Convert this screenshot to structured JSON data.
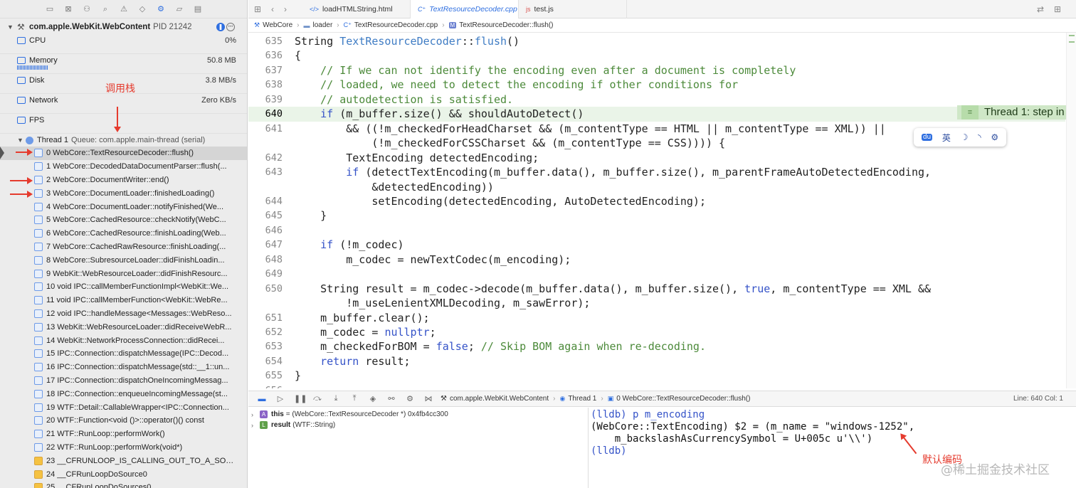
{
  "navigator": {
    "process": {
      "name": "com.apple.WebKit.WebContent",
      "pid": "PID 21242"
    },
    "gauges": [
      {
        "label": "CPU",
        "value": "0%"
      },
      {
        "label": "Memory",
        "value": "50.8 MB"
      },
      {
        "label": "Disk",
        "value": "3.8 MB/s"
      },
      {
        "label": "Network",
        "value": "Zero KB/s"
      },
      {
        "label": "FPS",
        "value": ""
      }
    ],
    "annotation": "调用栈",
    "thread": {
      "name": "Thread 1",
      "queue": "Queue: com.apple.main-thread (serial)"
    },
    "frames": [
      "0 WebCore::TextResourceDecoder::flush()",
      "1 WebCore::DecodedDataDocumentParser::flush(...",
      "2 WebCore::DocumentWriter::end()",
      "3 WebCore::DocumentLoader::finishedLoading()",
      "4 WebCore::DocumentLoader::notifyFinished(We...",
      "5 WebCore::CachedResource::checkNotify(WebC...",
      "6 WebCore::CachedResource::finishLoading(Web...",
      "7 WebCore::CachedRawResource::finishLoading(...",
      "8 WebCore::SubresourceLoader::didFinishLoadin...",
      "9 WebKit::WebResourceLoader::didFinishResourc...",
      "10 void IPC::callMemberFunctionImpl<WebKit::We...",
      "11 void IPC::callMemberFunction<WebKit::WebRe...",
      "12 void IPC::handleMessage<Messages::WebReso...",
      "13 WebKit::WebResourceLoader::didReceiveWebR...",
      "14 WebKit::NetworkProcessConnection::didRecei...",
      "15 IPC::Connection::dispatchMessage(IPC::Decod...",
      "16 IPC::Connection::dispatchMessage(std::__1::un...",
      "17 IPC::Connection::dispatchOneIncomingMessag...",
      "18 IPC::Connection::enqueueIncomingMessage(st...",
      "19 WTF::Detail::CallableWrapper<IPC::Connection...",
      "20 WTF::Function<void ()>::operator()() const",
      "21 WTF::RunLoop::performWork()",
      "22 WTF::RunLoop::performWork(void*)",
      "23 __CFRUNLOOP_IS_CALLING_OUT_TO_A_SOU...",
      "24 __CFRunLoopDoSource0",
      "25 __CFRunLoopDoSources0"
    ]
  },
  "tabs": [
    {
      "icon": "</>",
      "label": "loadHTMLString.html"
    },
    {
      "icon": "C⁺",
      "label": "TextResourceDecoder.cpp"
    },
    {
      "icon": "js",
      "label": "test.js"
    }
  ],
  "jumpbar": {
    "items": [
      "WebCore",
      "loader",
      "TextResourceDecoder.cpp",
      "TextResourceDecoder::flush()"
    ]
  },
  "editor": {
    "current_line": "640",
    "step_badge": "Thread 1: step in",
    "lines": [
      {
        "num": "635",
        "html": "String <span class=\"fn\">TextResourceDecoder</span>::<span class=\"fn\">flush</span>()"
      },
      {
        "num": "636",
        "html": "{"
      },
      {
        "num": "637",
        "html": "    <span class=\"cm\">// If we can not identify the encoding even after a document is completely</span>"
      },
      {
        "num": "638",
        "html": "    <span class=\"cm\">// loaded, we need to detect the encoding if other conditions for</span>"
      },
      {
        "num": "639",
        "html": "    <span class=\"cm\">// autodetection is satisfied.</span>"
      },
      {
        "num": "640",
        "html": "    <span class=\"kw\">if</span> (m_buffer.size() && shouldAutoDetect()"
      },
      {
        "num": "641",
        "html": "        && ((!m_checkedForHeadCharset && (m_contentType == HTML || m_contentType == XML)) ||"
      },
      {
        "num": "",
        "html": "            (!m_checkedForCSSCharset && (m_contentType == CSS)))) {"
      },
      {
        "num": "642",
        "html": "        TextEncoding detectedEncoding;"
      },
      {
        "num": "643",
        "html": "        <span class=\"kw\">if</span> (detectTextEncoding(m_buffer.data(), m_buffer.size(), m_parentFrameAutoDetectedEncoding,"
      },
      {
        "num": "",
        "html": "            &detectedEncoding))"
      },
      {
        "num": "644",
        "html": "            setEncoding(detectedEncoding, AutoDetectedEncoding);"
      },
      {
        "num": "645",
        "html": "    }"
      },
      {
        "num": "646",
        "html": ""
      },
      {
        "num": "647",
        "html": "    <span class=\"kw\">if</span> (!m_codec)"
      },
      {
        "num": "648",
        "html": "        m_codec = newTextCodec(m_encoding);"
      },
      {
        "num": "649",
        "html": ""
      },
      {
        "num": "650",
        "html": "    String result = m_codec->decode(m_buffer.data(), m_buffer.size(), <span class=\"kw\">true</span>, m_contentType == XML &&"
      },
      {
        "num": "",
        "html": "        !m_useLenientXMLDecoding, m_sawError);"
      },
      {
        "num": "651",
        "html": "    m_buffer.clear();"
      },
      {
        "num": "652",
        "html": "    m_codec = <span class=\"kw\">nullptr</span>;"
      },
      {
        "num": "653",
        "html": "    m_checkedForBOM = <span class=\"kw\">false</span>; <span class=\"cm\">// Skip BOM again when re-decoding.</span>"
      },
      {
        "num": "654",
        "html": "    <span class=\"kw\">return</span> result;"
      },
      {
        "num": "655",
        "html": "}"
      },
      {
        "num": "656",
        "html": ""
      }
    ]
  },
  "ime": {
    "logo": "du",
    "items": [
      "英",
      "☽",
      "◝",
      "⚙"
    ]
  },
  "debugbar": {
    "process": "com.apple.WebKit.WebContent",
    "thread": "Thread 1",
    "frame": "0 WebCore::TextResourceDecoder::flush()",
    "line_col": "Line: 640  Col: 1"
  },
  "variables": [
    {
      "badge": "A",
      "name": "this",
      "value": "= (WebCore::TextResourceDecoder *) 0x4fb4cc300"
    },
    {
      "badge": "L",
      "name": "result",
      "value": "(WTF::String)"
    }
  ],
  "console": {
    "lines": [
      "(lldb) p m_encoding",
      "(WebCore::TextEncoding) $2 = (m_name = \"windows-1252\",",
      "    m_backslashAsCurrencySymbol = U+005c u'\\\\')",
      "(lldb)"
    ],
    "annotation": "默认编码",
    "watermark": "@稀土掘金技术社区"
  },
  "colors": {
    "accent": "#2f6fe0",
    "annotation": "#e53b2e",
    "current_line": "#eaf4e8"
  }
}
